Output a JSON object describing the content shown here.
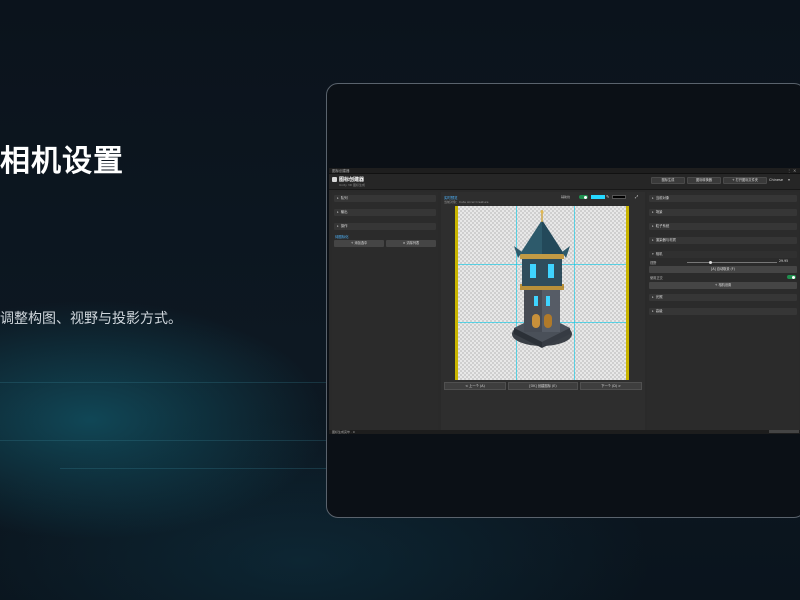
{
  "slide": {
    "heading": "相机设置",
    "subtitle": "调整构图、视野与投影方式。"
  },
  "app": {
    "window_title": "图标创建器",
    "title": "图标创建器",
    "subtitle": "Unity 3D 图标生成",
    "header_buttons": [
      "图标生成",
      "图标转换器",
      "+ 打开图标文件夹"
    ],
    "language": "Chinese",
    "left": {
      "sections": [
        "队列",
        "输出",
        "操作"
      ],
      "queue_label": "待图标化",
      "add_selected": "+ 添加选中",
      "clear": "× 清除列表"
    },
    "center": {
      "label": "实时预览",
      "object_line": "当前对象：Cute Arcel Creature",
      "toggle_label": "辅助线",
      "prev_button": "< 上一个 (A)",
      "ok_button": "[OK] 创建图标 (E)",
      "next_button": "下一个 (D) >"
    },
    "right": {
      "sections_top": [
        "当前对象",
        "场景",
        "粒子系统",
        "渲染器与材质"
      ],
      "camera_section": "相机",
      "fov_label": "视野",
      "fov_value": "29.95",
      "auto_frame_btn": "[A] 自动取景 (F)",
      "ortho_label": "使用正交",
      "camera_settings_btn": "+ 相机设置",
      "sections_bottom": [
        "光照",
        "高级"
      ]
    },
    "status_text": "图标生成完毕 · 0"
  },
  "colors": {
    "accent": "#4fb6ff",
    "guide": "#00c8e6",
    "toggle_on": "#1f8f4f",
    "bg_color_swatch": "#26d8ff",
    "preview_border": "#c8b400"
  }
}
